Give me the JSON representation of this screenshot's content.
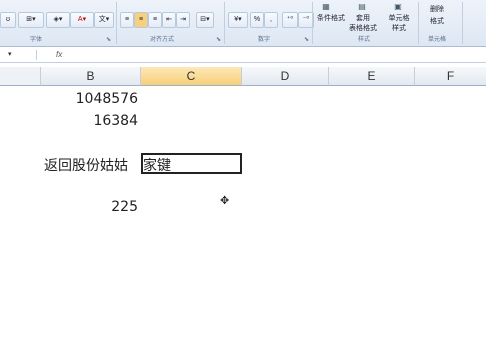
{
  "ribbon": {
    "groups": {
      "font": "字体",
      "alignment": "对齐方式",
      "number": "数字",
      "styles": "样式",
      "cells": "单元格"
    },
    "buttons": {
      "conditional_format": "条件格式",
      "format_table_1": "套用",
      "format_table_2": "表格格式",
      "cell_styles_1": "单元格",
      "cell_styles_2": "样式",
      "delete": "删除",
      "format": "格式",
      "percent": "%",
      "comma": ","
    }
  },
  "formula_bar": {
    "fx": "fx"
  },
  "sheet": {
    "columns": [
      "B",
      "C",
      "D",
      "E",
      "F"
    ],
    "selected_column": "C",
    "cells": {
      "b1": "1048576",
      "b2": "16384",
      "b4": "返回股份姑姑",
      "c4": "家键",
      "b6": "225"
    }
  },
  "colors": {
    "selected_header": "#f8cf7a",
    "ribbon_bg": "#dde7f3"
  }
}
